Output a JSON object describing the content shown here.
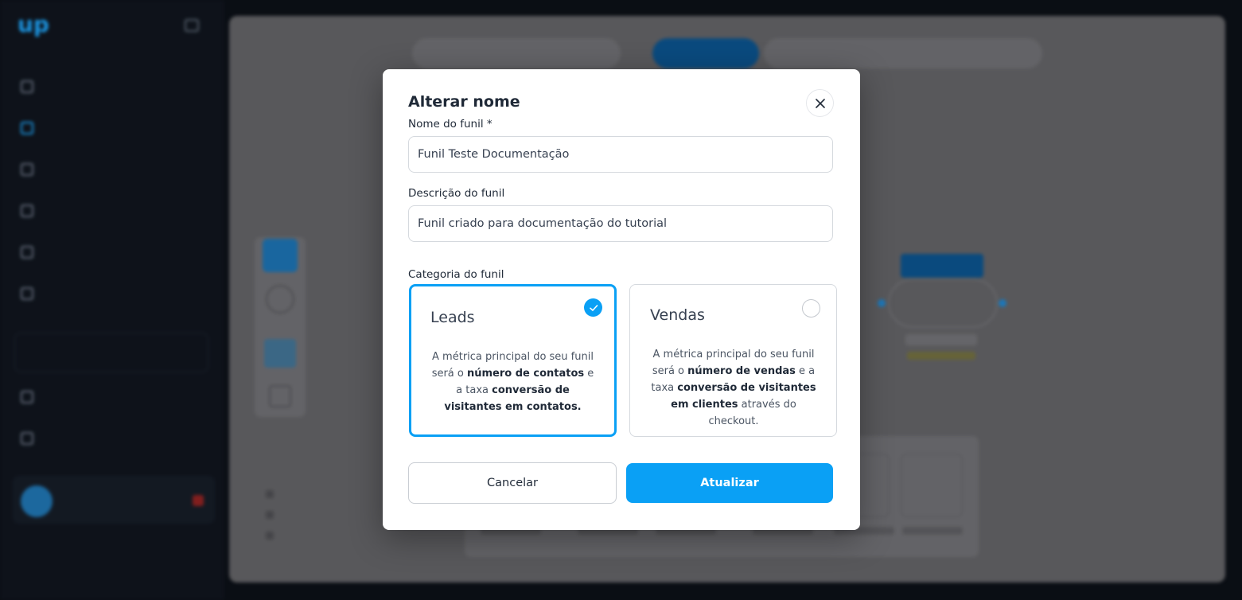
{
  "modal": {
    "title": "Alterar nome",
    "name_label": "Nome do funil *",
    "name_value": "Funil Teste Documentação",
    "desc_label": "Descrição do funil",
    "desc_value": "Funil criado para documentação do tutorial",
    "category_label": "Categoria do funil",
    "cards": [
      {
        "title": "Leads",
        "selected": true,
        "desc_pre": "A métrica principal do seu funil será o ",
        "desc_b1": "número de contatos",
        "desc_mid": " e a taxa ",
        "desc_b2": "conversão de visitantes em contatos.",
        "desc_post": ""
      },
      {
        "title": "Vendas",
        "selected": false,
        "desc_pre": "A métrica principal do seu funil será o ",
        "desc_b1": "número de vendas",
        "desc_mid": " e a taxa ",
        "desc_b2": "conversão de visitantes em clientes",
        "desc_post": " através do checkout."
      }
    ],
    "cancel_label": "Cancelar",
    "update_label": "Atualizar"
  },
  "icons": {
    "close": "close-icon",
    "check": "check-icon"
  },
  "colors": {
    "primary": "#0aa0f5",
    "backdrop": "#5e5e61",
    "sidebar": "#0f141c"
  }
}
